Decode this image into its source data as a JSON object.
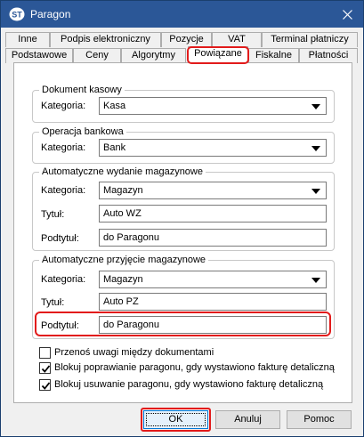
{
  "window": {
    "title": "Paragon",
    "app_icon_text": "ST"
  },
  "tabs_row1": [
    "Inne",
    "Podpis elektroniczny",
    "Pozycje",
    "VAT",
    "Terminal płatniczy"
  ],
  "tabs_row2": [
    "Podstawowe",
    "Ceny",
    "Algorytmy",
    "Powiązane",
    "Fiskalne",
    "Płatności"
  ],
  "active_tab": "Powiązane",
  "groups": {
    "dokument_kasowy": {
      "title": "Dokument kasowy",
      "kategoria_label": "Kategoria:",
      "kategoria_value": "Kasa"
    },
    "operacja_bankowa": {
      "title": "Operacja bankowa",
      "kategoria_label": "Kategoria:",
      "kategoria_value": "Bank"
    },
    "wydanie": {
      "title": "Automatyczne wydanie magazynowe",
      "kategoria_label": "Kategoria:",
      "kategoria_value": "Magazyn",
      "tytul_label": "Tytuł:",
      "tytul_value": "Auto WZ",
      "podtytul_label": "Podtytuł:",
      "podtytul_value": "do Paragonu"
    },
    "przyjecie": {
      "title": "Automatyczne przyjęcie magazynowe",
      "kategoria_label": "Kategoria:",
      "kategoria_value": "Magazyn",
      "tytul_label": "Tytuł:",
      "tytul_value": "Auto PZ",
      "podtytul_label": "Podtytuł:",
      "podtytul_value": "do Paragonu"
    }
  },
  "checkboxes": [
    {
      "label": "Przenoś uwagi między dokumentami",
      "checked": false
    },
    {
      "label": "Blokuj poprawianie paragonu, gdy wystawiono fakturę detaliczną",
      "checked": true
    },
    {
      "label": "Blokuj usuwanie paragonu, gdy wystawiono fakturę detaliczną",
      "checked": true
    }
  ],
  "buttons": {
    "ok": "OK",
    "cancel": "Anuluj",
    "help": "Pomoc"
  },
  "colors": {
    "titlebar": "#2b5797",
    "highlight": "#e21b1b",
    "default_button_border": "#0078d7"
  }
}
